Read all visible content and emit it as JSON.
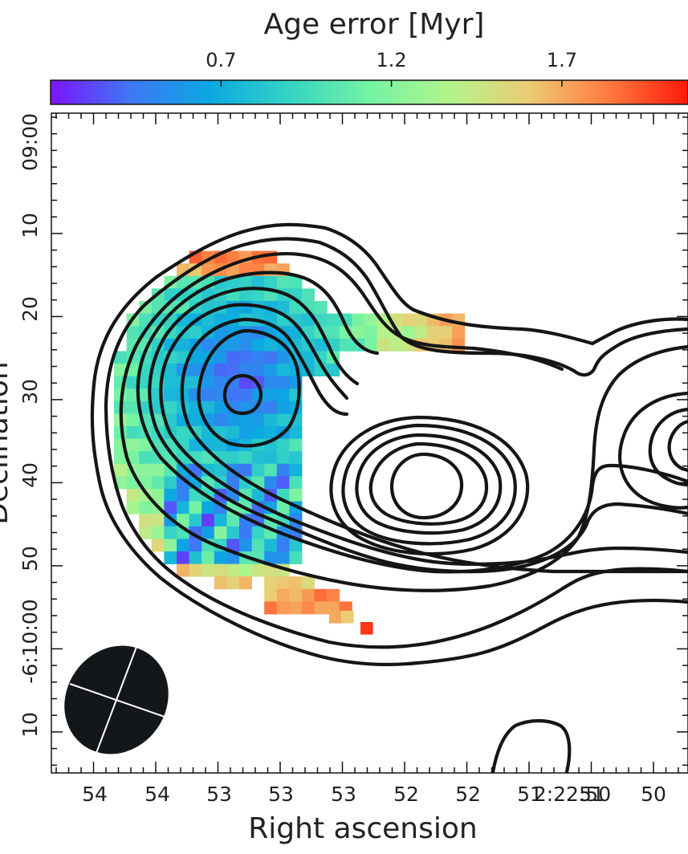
{
  "chart_data": {
    "type": "heatmap",
    "title": "",
    "xlabel": "Right ascension",
    "ylabel": "Declination",
    "x_tick_labels": [
      "54",
      "54",
      "53",
      "53",
      "53",
      "52",
      "52",
      "51",
      "51",
      "2:22:50",
      "50"
    ],
    "y_tick_labels": [
      "09:00",
      "10",
      "20",
      "30",
      "40",
      "50",
      "-6:10:00",
      "10"
    ],
    "colorbar": {
      "label": "Age error [Myr]",
      "ticks": [
        0.7,
        1.2,
        1.7
      ],
      "range": [
        0.2,
        2.07
      ],
      "colormap": "rainbow",
      "colors": [
        "#7c14ff",
        "#3f77f5",
        "#0ba8e2",
        "#35d4c4",
        "#74f3a3",
        "#b2f48c",
        "#eccc74",
        "#ff7a40",
        "#ff1a0b"
      ]
    },
    "heatmap_description": "Age-error map of a tail-shaped region; lowest errors (~0.3-0.6 Myr, violet/blue) near the inner contour peak, rising to ~1.0-1.4 Myr (cyan/green) outward and ~1.6-2.0 Myr (orange/red) on the upper rim.",
    "contours": "Black radio intensity contours with a main peak near RA 52s / Dec 41, a secondary peak near RA 53s / Dec 30, and a third source at the right edge.",
    "beam": "Filled black ellipse with white cross axes at lower-left.",
    "grid": false,
    "legend": "colorbar-top"
  }
}
